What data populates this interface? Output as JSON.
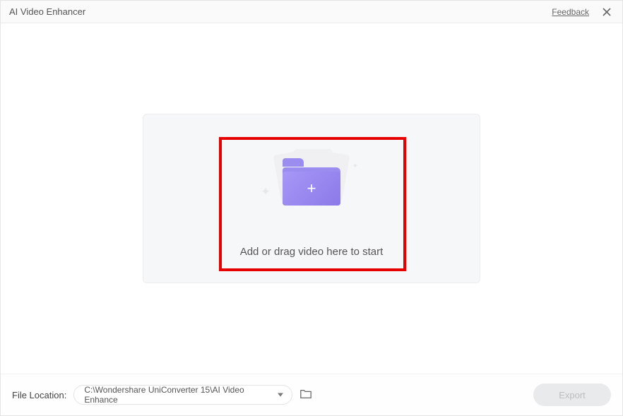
{
  "titlebar": {
    "title": "AI Video Enhancer",
    "feedback": "Feedback"
  },
  "dropzone": {
    "text": "Add or drag video here to start",
    "plus": "+"
  },
  "footer": {
    "location_label": "File Location:",
    "path": "C:\\Wondershare UniConverter 15\\AI Video Enhance",
    "export_label": "Export"
  }
}
